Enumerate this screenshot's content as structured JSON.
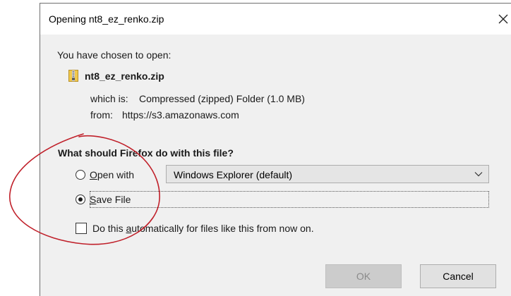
{
  "dialog": {
    "title": "Opening nt8_ez_renko.zip"
  },
  "file_info": {
    "chosen_text": "You have chosen to open:",
    "file_name": "nt8_ez_renko.zip",
    "type_label": "which is:",
    "type_value": "Compressed (zipped) Folder (1.0 MB)",
    "from_label": "from:",
    "from_value": "https://s3.amazonaws.com"
  },
  "action": {
    "question": "What should Firefox do with this file?",
    "open_with": {
      "pre": "",
      "accel": "O",
      "post": "pen with",
      "selected": false
    },
    "open_with_app": "Windows Explorer (default)",
    "save_file": {
      "pre": "",
      "accel": "S",
      "post": "ave File",
      "selected": true
    },
    "auto": {
      "pre": "Do this ",
      "accel": "a",
      "post": "utomatically for files like this from now on.",
      "checked": false
    }
  },
  "buttons": {
    "ok": "OK",
    "cancel": "Cancel"
  },
  "colors": {
    "annotation_circle": "#c0202a",
    "dialog_bg": "#f0f0f0",
    "titlebar_bg": "#ffffff"
  }
}
